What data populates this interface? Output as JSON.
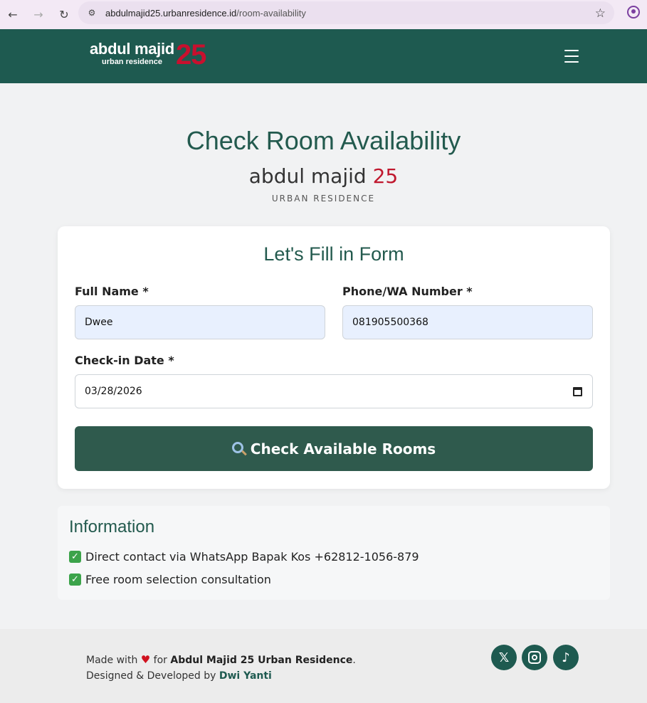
{
  "browser": {
    "url_domain": "abdulmajid25.urbanresidence.id",
    "url_path": "/room-availability"
  },
  "header": {
    "logo_main": "abdul majid",
    "logo_sub": "urban residence",
    "logo_num": "25"
  },
  "hero": {
    "title": "Check Room Availability",
    "brand_name": "abdul majid",
    "brand_num": "25",
    "brand_sub": "URBAN RESIDENCE"
  },
  "form": {
    "title": "Let's Fill in Form",
    "full_name_label": "Full Name *",
    "full_name_value": "Dwee",
    "phone_label": "Phone/WA Number *",
    "phone_value": "081905500368",
    "checkin_label": "Check-in Date *",
    "checkin_value": "03/28/2026",
    "submit_label": "Check Available Rooms"
  },
  "info": {
    "title": "Information",
    "items": [
      "Direct contact via WhatsApp Bapak Kos +62812-1056-879",
      "Free room selection consultation"
    ]
  },
  "footer": {
    "made_with": "Made with",
    "for_text": "for",
    "org": "Abdul Majid 25 Urban Residence",
    "designed_by": "Designed & Developed by",
    "developer": "Dwi Yanti",
    "x_glyph": "𝕏",
    "tiktok_glyph": "♪"
  },
  "colors": {
    "brand_green": "#1e5a50",
    "brand_red": "#c8102e",
    "button_green": "#2f5a4d"
  }
}
